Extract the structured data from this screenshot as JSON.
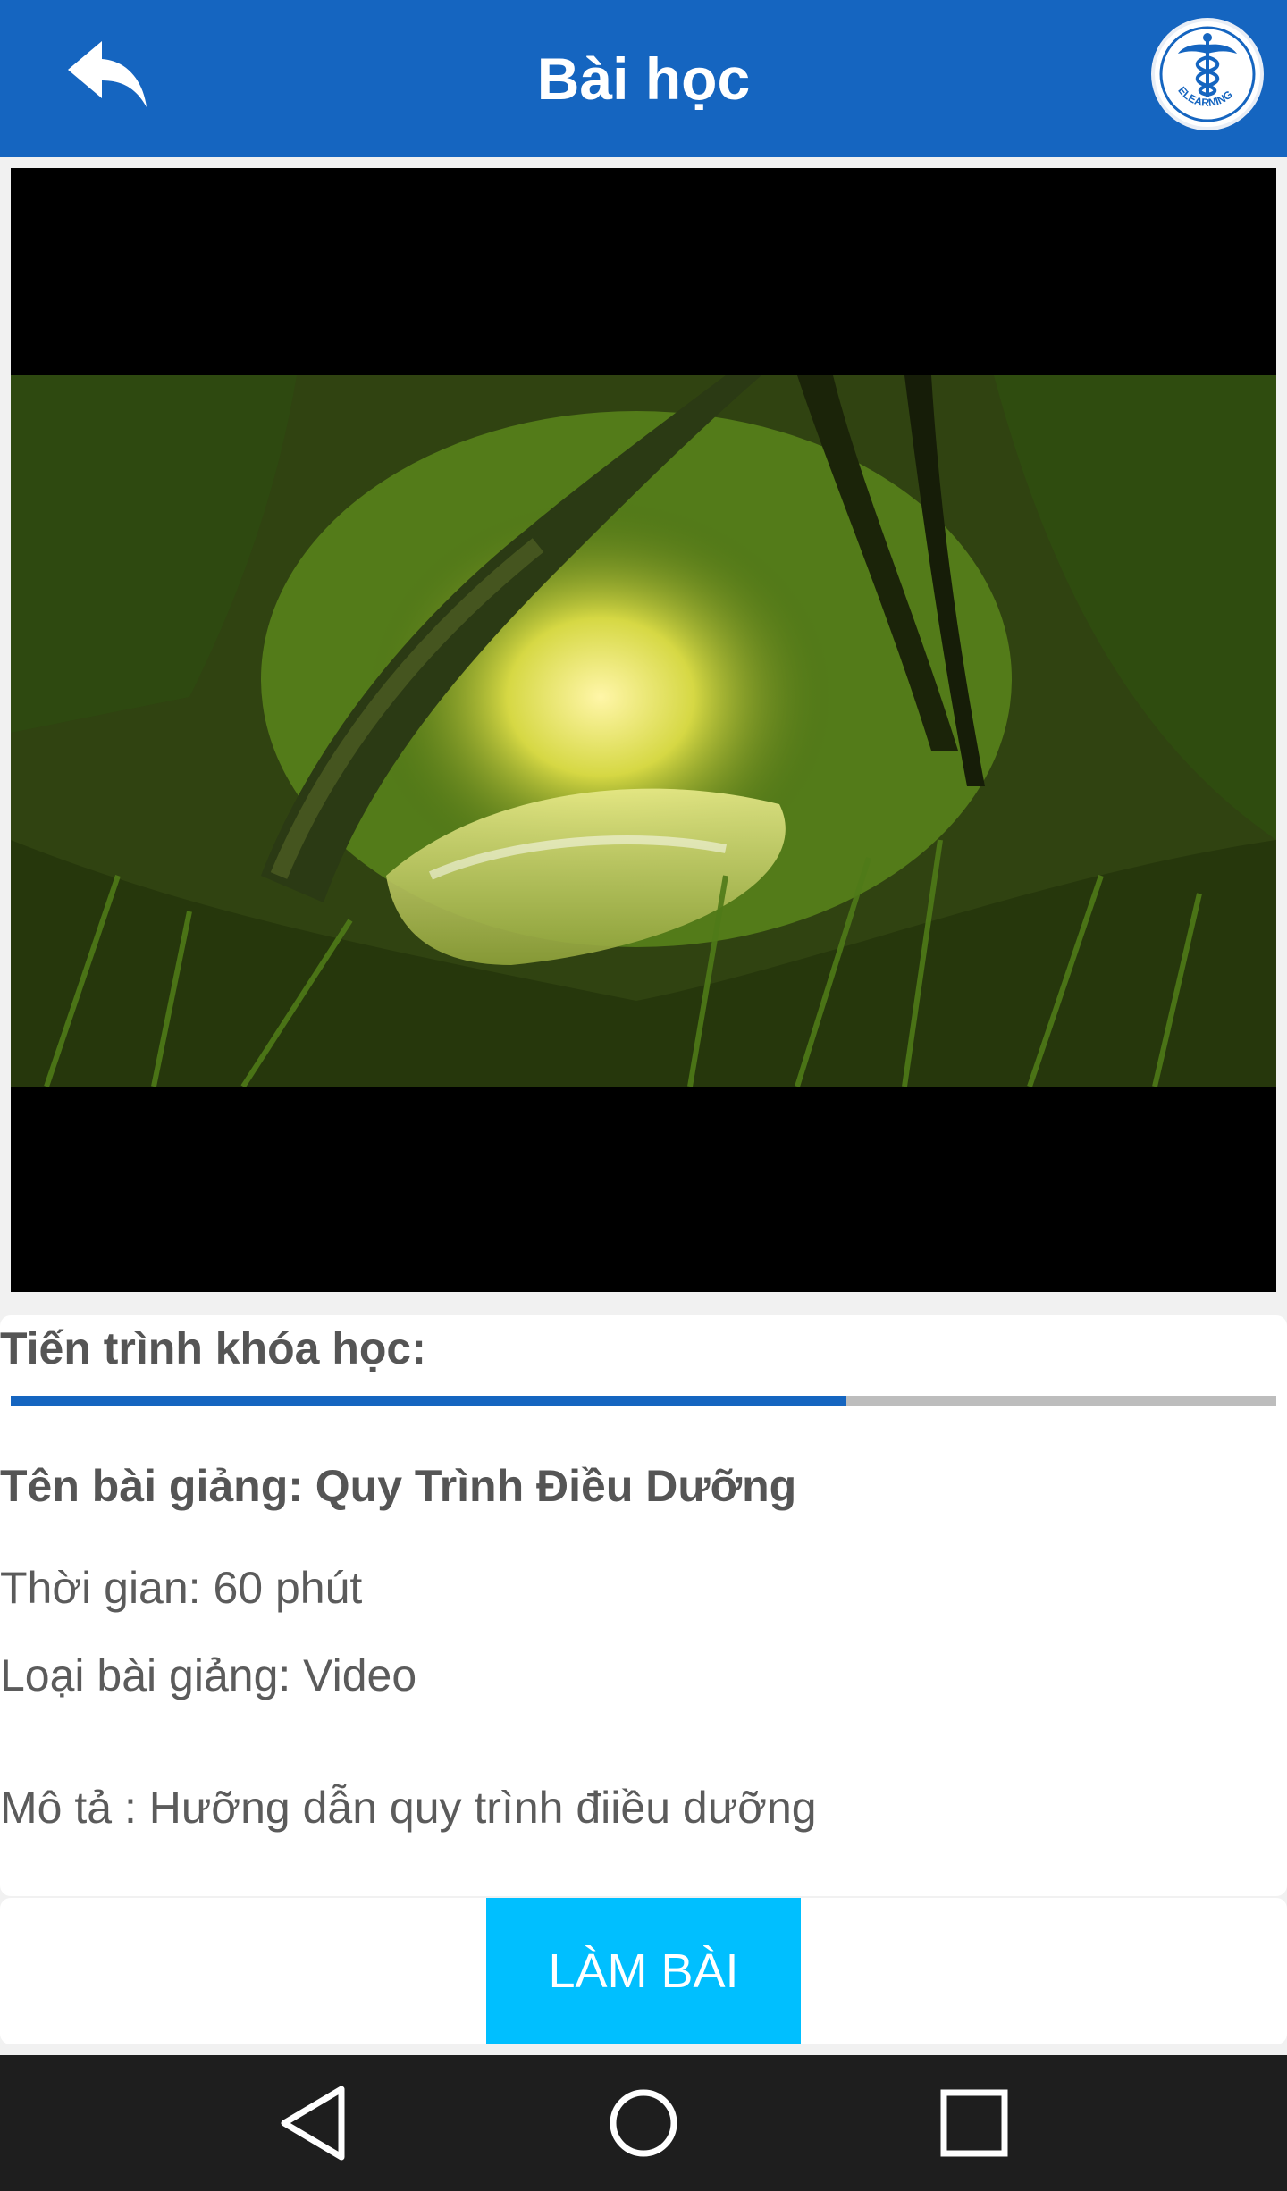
{
  "app_bar": {
    "title": "Bài học",
    "back_icon": "reply-arrow-icon",
    "logo_icon": "caduceus-elearning-logo",
    "logo_text": "ELEARNING",
    "color": "#1565c0"
  },
  "video": {
    "thumbnail": "forest-river-scene",
    "background": "#000000"
  },
  "progress": {
    "label": "Tiến trình khóa học:",
    "value": 0.66,
    "fill_color": "#1565c0",
    "track_color": "#bdbdbd"
  },
  "lesson": {
    "name": "Tên bài giảng: Quy Trình Điều Dưỡng",
    "duration": "Thời gian: 60 phút",
    "type": "Loại bài giảng: Video",
    "description": "Mô tả : Hưỡng dẫn quy trình điiều dưỡng"
  },
  "action": {
    "do_lesson_label": "LÀM BÀI",
    "color": "#00bfff"
  },
  "system_nav": {
    "back_icon": "triangle-back-icon",
    "home_icon": "circle-home-icon",
    "recents_icon": "square-recents-icon"
  }
}
